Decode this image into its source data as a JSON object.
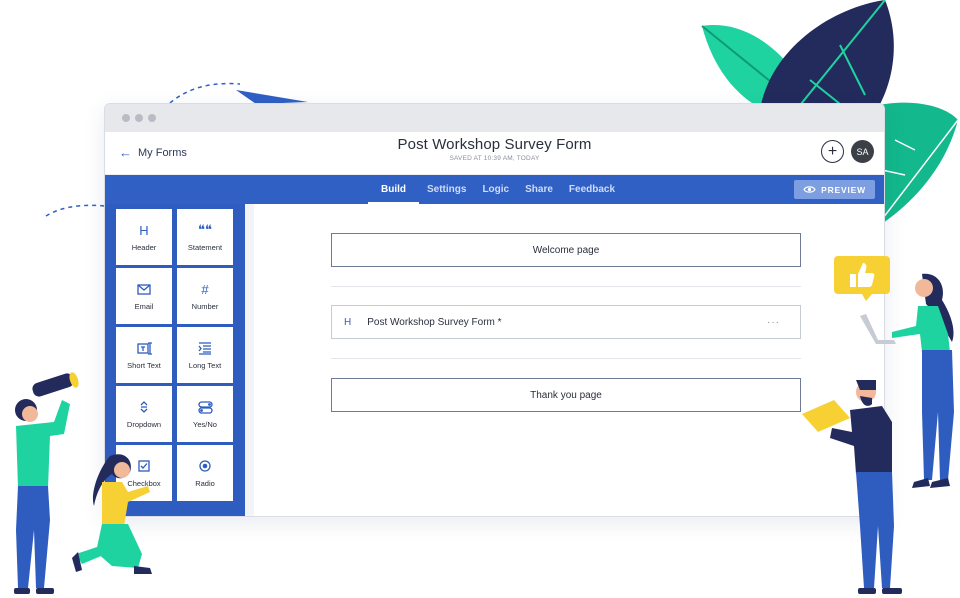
{
  "window": {
    "back_label": "My Forms",
    "title": "Post Workshop Survey Form",
    "saved_status": "SAVED AT 10:39 AM, TODAY",
    "add_label": "+",
    "avatar_initials": "SA"
  },
  "navbar": {
    "tabs": [
      "Build",
      "Settings",
      "Logic",
      "Share",
      "Feedback"
    ],
    "active_tab": "Build",
    "preview_label": "PREVIEW"
  },
  "sidebar": {
    "blocks": [
      {
        "label": "Header",
        "icon": "H"
      },
      {
        "label": "Statement",
        "icon": "quote-icon"
      },
      {
        "label": "Email",
        "icon": "envelope-icon"
      },
      {
        "label": "Number",
        "icon": "#"
      },
      {
        "label": "Short Text",
        "icon": "short-text-icon"
      },
      {
        "label": "Long Text",
        "icon": "long-text-icon"
      },
      {
        "label": "Dropdown",
        "icon": "dropdown-arrows-icon"
      },
      {
        "label": "Yes/No",
        "icon": "toggle-icon"
      },
      {
        "label": "Checkbox",
        "icon": "checkbox-icon"
      },
      {
        "label": "Radio",
        "icon": "radio-icon"
      }
    ]
  },
  "canvas": {
    "welcome_label": "Welcome page",
    "question": {
      "icon": "H",
      "title": "Post Workshop Survey Form *",
      "more": "···"
    },
    "thankyou_label": "Thank you page"
  },
  "colors": {
    "primary": "#3060c4",
    "leaf_green": "#1fd3a0",
    "leaf_navy": "#232a5c",
    "leaf_teal": "#13b88c",
    "bubble_yellow": "#f7d033"
  }
}
